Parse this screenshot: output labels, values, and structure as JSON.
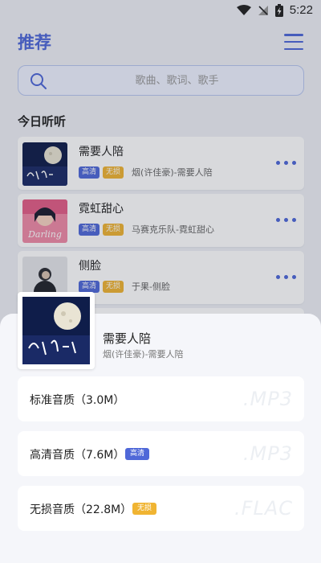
{
  "status_bar": {
    "time": "5:22"
  },
  "header": {
    "title": "推荐"
  },
  "search": {
    "placeholder": "歌曲、歌词、歌手"
  },
  "section": {
    "title": "今日听听"
  },
  "songs": [
    {
      "title": "需要人陪",
      "tag_hd": "高清",
      "tag_ll": "无损",
      "artist": "烟(许佳豪)-需要人陪"
    },
    {
      "title": "霓虹甜心",
      "tag_hd": "高清",
      "tag_ll": "无损",
      "artist": "马赛克乐队-霓虹甜心"
    },
    {
      "title": "侧脸",
      "tag_hd": "高清",
      "tag_ll": "无损",
      "artist": "于果-侧脸"
    }
  ],
  "covers": {
    "song2_word": "Darling"
  },
  "sheet": {
    "title": "需要人陪",
    "subtitle": "烟(许佳豪)-需要人陪",
    "options": [
      {
        "label": "标准音质（3.0M）",
        "tag": "",
        "format": ".MP3"
      },
      {
        "label": "高清音质（7.6M）",
        "tag": "高清",
        "format": ".MP3"
      },
      {
        "label": "无损音质（22.8M）",
        "tag": "无损",
        "format": ".FLAC"
      }
    ]
  },
  "colors": {
    "accent": "#4d67d8",
    "hd_tag": "#4f68d8",
    "lossless_tag": "#f0b432"
  }
}
